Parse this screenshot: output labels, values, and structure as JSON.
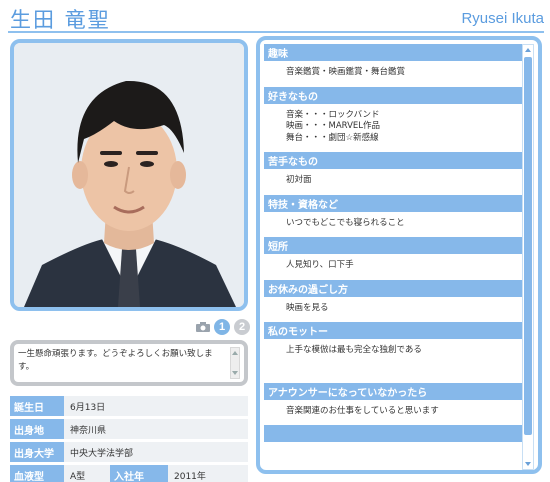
{
  "header": {
    "name_jp": "生田 竜聖",
    "name_en": "Ryusei Ikuta"
  },
  "photo": {
    "pages": [
      "1",
      "2"
    ],
    "current_page": "1"
  },
  "message": {
    "text": "一生懸命頑張ります。どうぞよろしくお願い致します。"
  },
  "profile": {
    "birthday_label": "誕生日",
    "birthday": "6月13日",
    "birthplace_label": "出身地",
    "birthplace": "神奈川県",
    "university_label": "出身大学",
    "university": "中央大学法学部",
    "blood_label": "血液型",
    "blood": "A型",
    "join_label": "入社年",
    "join": "2011年"
  },
  "sections": [
    {
      "title": "趣味",
      "lines": [
        "音楽鑑賞・映画鑑賞・舞台鑑賞"
      ]
    },
    {
      "title": "好きなもの",
      "lines": [
        "音楽・・・ロックバンド",
        "映画・・・MARVEL作品",
        "舞台・・・劇団☆新感線"
      ]
    },
    {
      "title": "苦手なもの",
      "lines": [
        "初対面"
      ]
    },
    {
      "title": "特技・資格など",
      "lines": [
        "いつでもどこでも寝られること"
      ]
    },
    {
      "title": "短所",
      "lines": [
        "人見知り、口下手"
      ]
    },
    {
      "title": "お休みの過ごし方",
      "lines": [
        "映画を見る"
      ]
    },
    {
      "title": "私のモットー",
      "lines": [
        "上手な模倣は最も完全な独創である",
        ""
      ]
    },
    {
      "title": "アナウンサーになっていなかったら",
      "lines": [
        "音楽関連のお仕事をしていると思います"
      ]
    },
    {
      "title": "",
      "lines": []
    }
  ],
  "colors": {
    "accent": "#8ec0ee",
    "label_bg": "#86b8ea",
    "title_text": "#5b9cdf",
    "value_bg": "#eef1f4"
  },
  "icons": {
    "camera": "camera-icon",
    "scroll_up": "scroll-up-arrow-icon",
    "scroll_down": "scroll-down-arrow-icon"
  }
}
